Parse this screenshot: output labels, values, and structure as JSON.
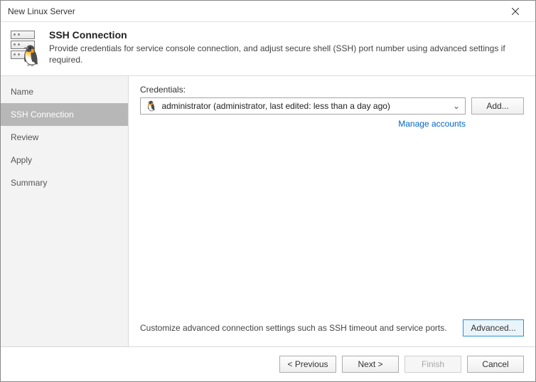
{
  "window": {
    "title": "New Linux Server"
  },
  "header": {
    "title": "SSH Connection",
    "description": "Provide credentials for service console connection, and adjust secure shell (SSH) port number using advanced settings if required."
  },
  "sidebar": {
    "items": [
      {
        "label": "Name"
      },
      {
        "label": "SSH Connection"
      },
      {
        "label": "Review"
      },
      {
        "label": "Apply"
      },
      {
        "label": "Summary"
      }
    ],
    "active_index": 1
  },
  "content": {
    "credentials_label": "Credentials:",
    "credentials_selected": "administrator (administrator, last edited: less than a day ago)",
    "add_button": "Add...",
    "manage_accounts": "Manage accounts",
    "advanced_text": "Customize advanced connection settings such as SSH timeout and service ports.",
    "advanced_button": "Advanced..."
  },
  "footer": {
    "previous": "< Previous",
    "next": "Next >",
    "finish": "Finish",
    "cancel": "Cancel"
  }
}
